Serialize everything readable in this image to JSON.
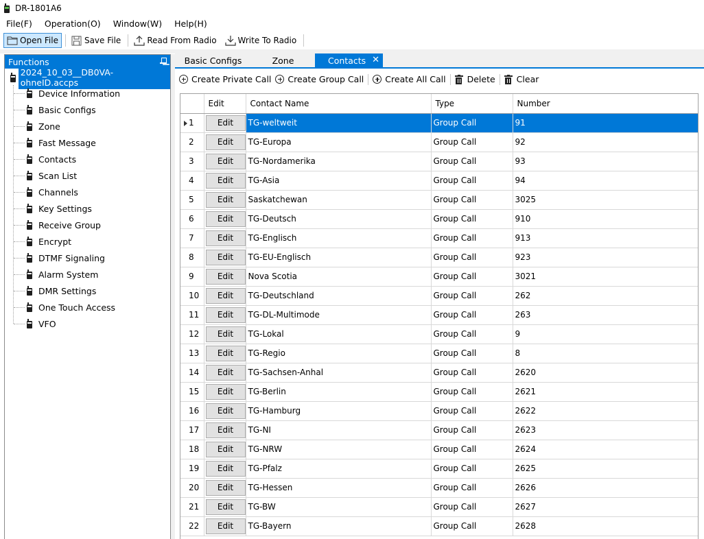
{
  "window": {
    "title": "DR-1801A6"
  },
  "menu": [
    {
      "label": "File(F)"
    },
    {
      "label": "Operation(O)"
    },
    {
      "label": "Window(W)"
    },
    {
      "label": "Help(H)"
    }
  ],
  "toolbar": {
    "open_file": "Open File",
    "save_file": "Save File",
    "read_from_radio": "Read From Radio",
    "write_to_radio": "Write To Radio"
  },
  "functions_panel": {
    "title": "Functions",
    "root_label": "2024_10_03__DB0VA-ohneID.accps",
    "items": [
      {
        "label": "Device Information"
      },
      {
        "label": "Basic Configs"
      },
      {
        "label": "Zone"
      },
      {
        "label": "Fast Message"
      },
      {
        "label": "Contacts"
      },
      {
        "label": "Scan List"
      },
      {
        "label": "Channels"
      },
      {
        "label": "Key Settings"
      },
      {
        "label": "Receive Group"
      },
      {
        "label": "Encrypt"
      },
      {
        "label": "DTMF Signaling"
      },
      {
        "label": "Alarm System"
      },
      {
        "label": "DMR Settings"
      },
      {
        "label": "One Touch Access"
      },
      {
        "label": "VFO"
      }
    ]
  },
  "tabs": [
    {
      "label": "Basic Configs"
    },
    {
      "label": "Zone"
    },
    {
      "label": "Contacts",
      "close": "✕"
    }
  ],
  "contacts_toolbar": {
    "create_private_call": "Create Private Call",
    "create_group_call": "Create Group Call",
    "create_all_call": "Create All Call",
    "delete": "Delete",
    "clear": "Clear"
  },
  "grid": {
    "columns": {
      "edit": "Edit",
      "contact_name": "Contact Name",
      "type": "Type",
      "number": "Number"
    },
    "edit_label": "Edit",
    "selected_row": 1,
    "rows": [
      {
        "idx": "1",
        "name": "TG-weltweit",
        "type": "Group Call",
        "number": "91"
      },
      {
        "idx": "2",
        "name": "TG-Europa",
        "type": "Group Call",
        "number": "92"
      },
      {
        "idx": "3",
        "name": "TG-Nordamerika",
        "type": "Group Call",
        "number": "93"
      },
      {
        "idx": "4",
        "name": "TG-Asia",
        "type": "Group Call",
        "number": "94"
      },
      {
        "idx": "5",
        "name": "Saskatchewan",
        "type": "Group Call",
        "number": "3025"
      },
      {
        "idx": "6",
        "name": "TG-Deutsch",
        "type": "Group Call",
        "number": "910"
      },
      {
        "idx": "7",
        "name": "TG-Englisch",
        "type": "Group Call",
        "number": "913"
      },
      {
        "idx": "8",
        "name": "TG-EU-Englisch",
        "type": "Group Call",
        "number": "923"
      },
      {
        "idx": "9",
        "name": "Nova Scotia",
        "type": "Group Call",
        "number": "3021"
      },
      {
        "idx": "10",
        "name": "TG-Deutschland",
        "type": "Group Call",
        "number": "262"
      },
      {
        "idx": "11",
        "name": "TG-DL-Multimode",
        "type": "Group Call",
        "number": "263"
      },
      {
        "idx": "12",
        "name": "TG-Lokal",
        "type": "Group Call",
        "number": "9"
      },
      {
        "idx": "13",
        "name": "TG-Regio",
        "type": "Group Call",
        "number": "8"
      },
      {
        "idx": "14",
        "name": "TG-Sachsen-Anhal",
        "type": "Group Call",
        "number": "2620"
      },
      {
        "idx": "15",
        "name": "TG-Berlin",
        "type": "Group Call",
        "number": "2621"
      },
      {
        "idx": "16",
        "name": "TG-Hamburg",
        "type": "Group Call",
        "number": "2622"
      },
      {
        "idx": "17",
        "name": "TG-NI",
        "type": "Group Call",
        "number": "2623"
      },
      {
        "idx": "18",
        "name": "TG-NRW",
        "type": "Group Call",
        "number": "2624"
      },
      {
        "idx": "19",
        "name": "TG-Pfalz",
        "type": "Group Call",
        "number": "2625"
      },
      {
        "idx": "20",
        "name": "TG-Hessen",
        "type": "Group Call",
        "number": "2626"
      },
      {
        "idx": "21",
        "name": "TG-BW",
        "type": "Group Call",
        "number": "2627"
      },
      {
        "idx": "22",
        "name": "TG-Bayern",
        "type": "Group Call",
        "number": "2628"
      }
    ]
  }
}
